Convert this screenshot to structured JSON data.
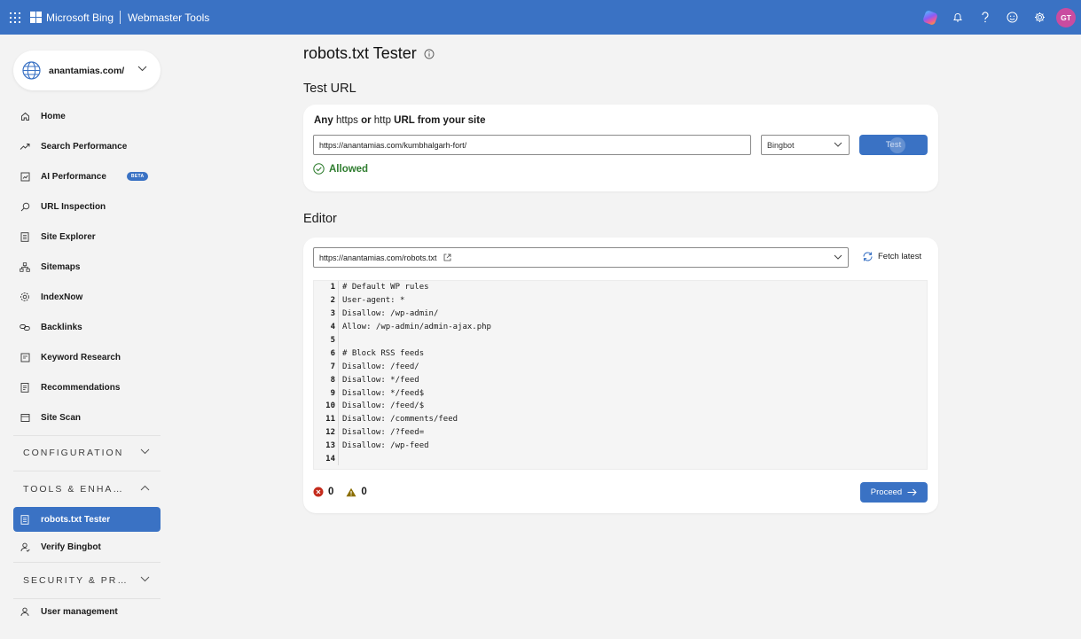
{
  "topbar": {
    "brand": "Microsoft Bing",
    "product": "Webmaster Tools",
    "avatar_initials": "GT",
    "icons": [
      "app-launcher-icon",
      "copilot-icon",
      "bell-icon",
      "help-icon",
      "feedback-smiley-icon",
      "gear-icon"
    ]
  },
  "sidebar": {
    "site": "anantamias.com/",
    "items": [
      {
        "label": "Home",
        "icon": "home-icon"
      },
      {
        "label": "Search Performance",
        "icon": "trend-icon"
      },
      {
        "label": "AI Performance",
        "icon": "ai-performance-icon",
        "badge": "BETA"
      },
      {
        "label": "URL Inspection",
        "icon": "search-icon"
      },
      {
        "label": "Site Explorer",
        "icon": "document-icon"
      },
      {
        "label": "Sitemaps",
        "icon": "sitemap-icon"
      },
      {
        "label": "IndexNow",
        "icon": "gear-icon"
      },
      {
        "label": "Backlinks",
        "icon": "link-icon"
      },
      {
        "label": "Keyword Research",
        "icon": "keyword-icon"
      },
      {
        "label": "Recommendations",
        "icon": "clipboard-icon"
      },
      {
        "label": "Site Scan",
        "icon": "scan-icon"
      }
    ],
    "sections": {
      "configuration": "CONFIGURATION",
      "tools": "TOOLS & ENHANCEMENTS",
      "security": "SECURITY & PRIVACY"
    },
    "tools_items": [
      {
        "label": "robots.txt Tester",
        "active": true
      },
      {
        "label": "Verify Bingbot",
        "active": false
      }
    ],
    "bottom_items": [
      {
        "label": "User management"
      }
    ]
  },
  "main": {
    "title": "robots.txt Tester",
    "test_url": {
      "heading": "Test URL",
      "label_any": "Any",
      "label_https": "https",
      "label_or": "or",
      "label_http": "http",
      "label_rest": "URL from your site",
      "url_value": "https://anantamias.com/kumbhalgarh-fort/",
      "bot_value": "Bingbot",
      "test_button": "Test",
      "status": "Allowed"
    },
    "editor": {
      "heading": "Editor",
      "robots_url": "https://anantamias.com/robots.txt",
      "fetch_label": "Fetch latest",
      "lines": [
        "# Default WP rules",
        "User-agent: *",
        "Disallow: /wp-admin/",
        "Allow: /wp-admin/admin-ajax.php",
        "",
        "# Block RSS feeds",
        "Disallow: /feed/",
        "Disallow: */feed",
        "Disallow: */feed$",
        "Disallow: /feed/$",
        "Disallow: /comments/feed",
        "Disallow: /?feed=",
        "Disallow: /wp-feed",
        ""
      ],
      "line_numbers": [
        "1",
        "2",
        "3",
        "4",
        "5",
        "6",
        "7",
        "8",
        "9",
        "10",
        "11",
        "12",
        "13",
        "14"
      ],
      "error_count": "0",
      "warning_count": "0",
      "proceed_label": "Proceed"
    }
  },
  "colors": {
    "accent": "#3a72c4",
    "allowed": "#2f7d2f",
    "error": "#c42b1c",
    "warning": "#8a6d00"
  }
}
